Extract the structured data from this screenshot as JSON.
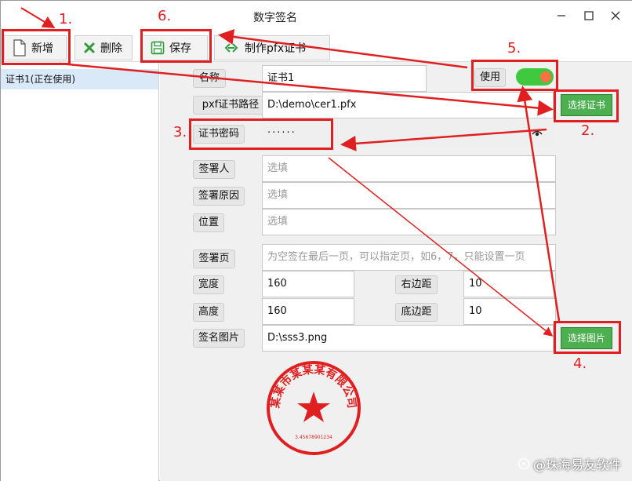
{
  "window": {
    "title": "数字签名"
  },
  "toolbar": {
    "new_label": "新增",
    "delete_label": "删除",
    "save_label": "保存",
    "make_pfx_label": "制作pfx证书"
  },
  "cert_list": [
    {
      "label": "证书1(正在使用)",
      "selected": true
    }
  ],
  "form": {
    "name_label": "名称",
    "name_value": "证书1",
    "use_label": "使用",
    "use_enabled": true,
    "pfx_path_label": "pxf证书路径",
    "pfx_path_value": "D:\\demo\\cer1.pfx",
    "choose_cert_label": "选择证书",
    "password_label": "证书密码",
    "password_value": "······",
    "signer_label": "签署人",
    "signer_placeholder": "选填",
    "reason_label": "签署原因",
    "reason_placeholder": "选填",
    "location_label": "位置",
    "location_placeholder": "选填",
    "page_label": "签署页",
    "page_placeholder": "为空签在最后一页，可以指定页，如6，7，只能设置一页",
    "width_label": "宽度",
    "width_value": "160",
    "right_margin_label": "右边距",
    "right_margin_value": "10",
    "height_label": "高度",
    "height_value": "160",
    "bottom_margin_label": "底边距",
    "bottom_margin_value": "10",
    "sign_image_label": "签名图片",
    "sign_image_value": "D:\\sss3.png",
    "choose_image_label": "选择图片"
  },
  "stamp": {
    "text": "某某市某某某有限公司",
    "number": "3.45678901234",
    "color": "#e02020"
  },
  "annotations": {
    "step1": "1.",
    "step2": "2.",
    "step3": "3.",
    "step4": "4.",
    "step5": "5.",
    "step6": "6.",
    "color": "#e02020"
  },
  "watermark": "@珠海易友软件",
  "colors": {
    "accent_green": "#4caf50",
    "toggle_on": "#3ec93e",
    "selection": "#d9e9f7"
  }
}
